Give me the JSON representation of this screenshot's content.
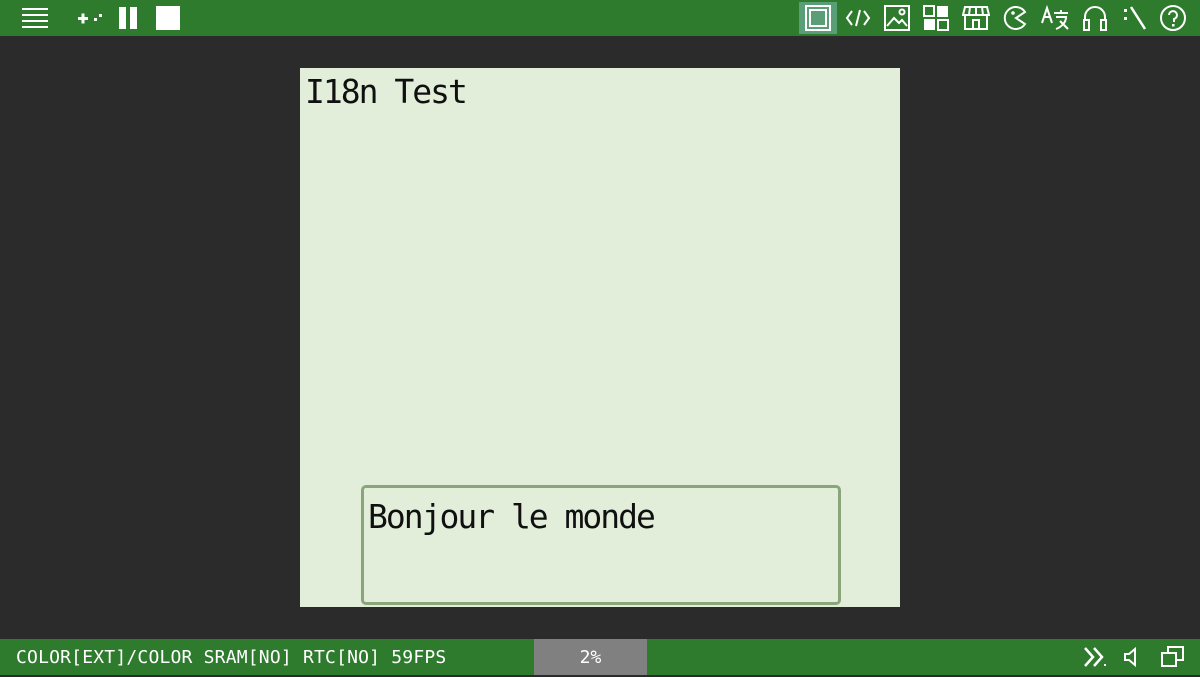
{
  "toolbar": {
    "left_icons": [
      "menu-icon",
      "gamepad-icon",
      "pause-icon",
      "stop-icon"
    ],
    "right_icons": [
      "screen-icon",
      "code-icon",
      "image-icon",
      "tiles-icon",
      "shop-icon",
      "pacman-icon",
      "translate-icon",
      "headphones-icon",
      "cheat-icon",
      "help-icon"
    ],
    "active_icon": "screen-icon"
  },
  "screen": {
    "title": "I18n Test",
    "dialog_text": "Bonjour le monde"
  },
  "status": {
    "info": "COLOR[EXT]/COLOR SRAM[NO] RTC[NO] 59FPS",
    "speed": "2%",
    "right_icons": [
      "fast-forward-icon",
      "volume-icon",
      "window-icon"
    ]
  },
  "colors": {
    "bar": "#2e7b2e",
    "background": "#2b2b2b",
    "screen": "#e2eed9",
    "dialog_border": "#89a57a",
    "speed_box": "#808080",
    "active_icon_bg": "#5a9e77"
  }
}
